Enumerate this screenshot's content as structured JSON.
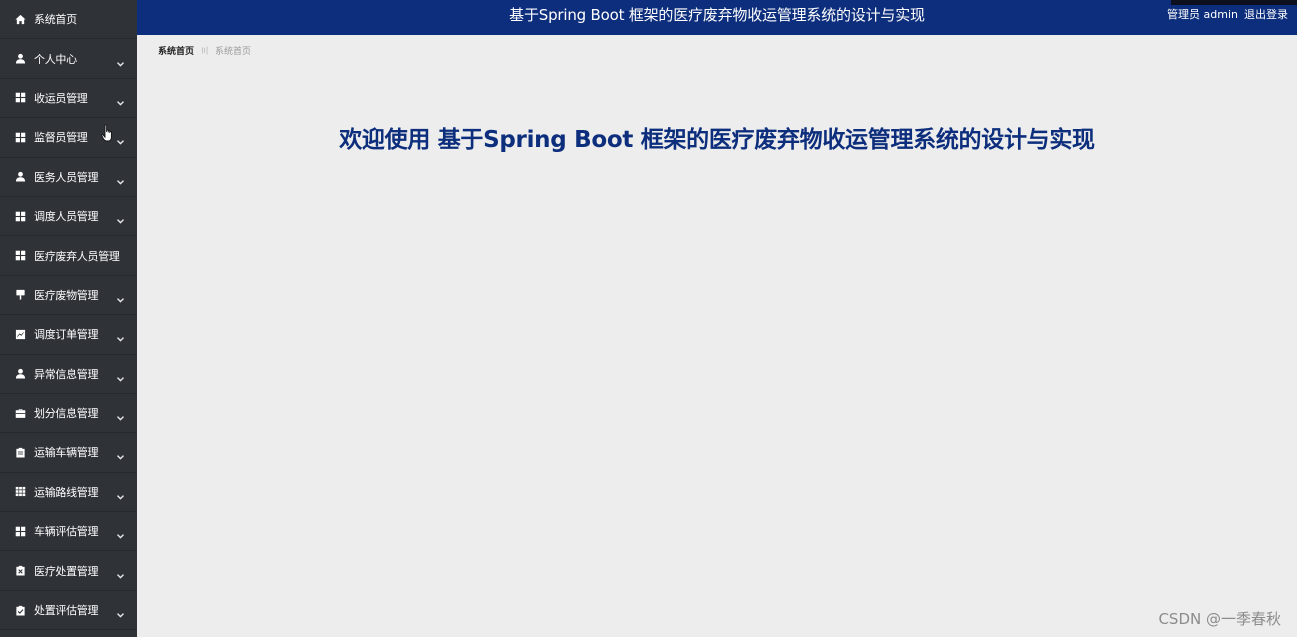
{
  "sidebar": {
    "items": [
      {
        "label": "系统首页",
        "icon": "home-icon",
        "expandable": false
      },
      {
        "label": "个人中心",
        "icon": "user-icon",
        "expandable": true
      },
      {
        "label": "收运员管理",
        "icon": "grid-icon",
        "expandable": true
      },
      {
        "label": "监督员管理",
        "icon": "grid-icon",
        "expandable": true
      },
      {
        "label": "医务人员管理",
        "icon": "user-icon",
        "expandable": true
      },
      {
        "label": "调度人员管理",
        "icon": "grid-icon",
        "expandable": true
      },
      {
        "label": "医疗废弃人员管理",
        "icon": "grid-icon",
        "expandable": false
      },
      {
        "label": "医疗废物管理",
        "icon": "flag-icon",
        "expandable": true
      },
      {
        "label": "调度订单管理",
        "icon": "chart-icon",
        "expandable": true
      },
      {
        "label": "异常信息管理",
        "icon": "user-icon",
        "expandable": true
      },
      {
        "label": "划分信息管理",
        "icon": "briefcase-icon",
        "expandable": true
      },
      {
        "label": "运输车辆管理",
        "icon": "clipboard-icon",
        "expandable": true
      },
      {
        "label": "运输路线管理",
        "icon": "table-icon",
        "expandable": true
      },
      {
        "label": "车辆评估管理",
        "icon": "grid-icon",
        "expandable": true
      },
      {
        "label": "医疗处置管理",
        "icon": "clipboard-x-icon",
        "expandable": true
      },
      {
        "label": "处置评估管理",
        "icon": "clipboard-check-icon",
        "expandable": true
      }
    ]
  },
  "header": {
    "title": "基于Spring Boot 框架的医疗废弃物收运管理系统的设计与实现",
    "user": "管理员 admin",
    "logout": "退出登录"
  },
  "breadcrumb": {
    "home": "系统首页",
    "separator": "〣",
    "current": "系统首页"
  },
  "main": {
    "welcome": "欢迎使用 基于Spring Boot 框架的医疗废弃物收运管理系统的设计与实现"
  },
  "watermark": "CSDN @一季春秋",
  "colors": {
    "sidebar_bg": "#2f3338",
    "header_bg": "#0d2e7c",
    "content_bg": "#ededed",
    "welcome_text": "#0d2e7c"
  }
}
